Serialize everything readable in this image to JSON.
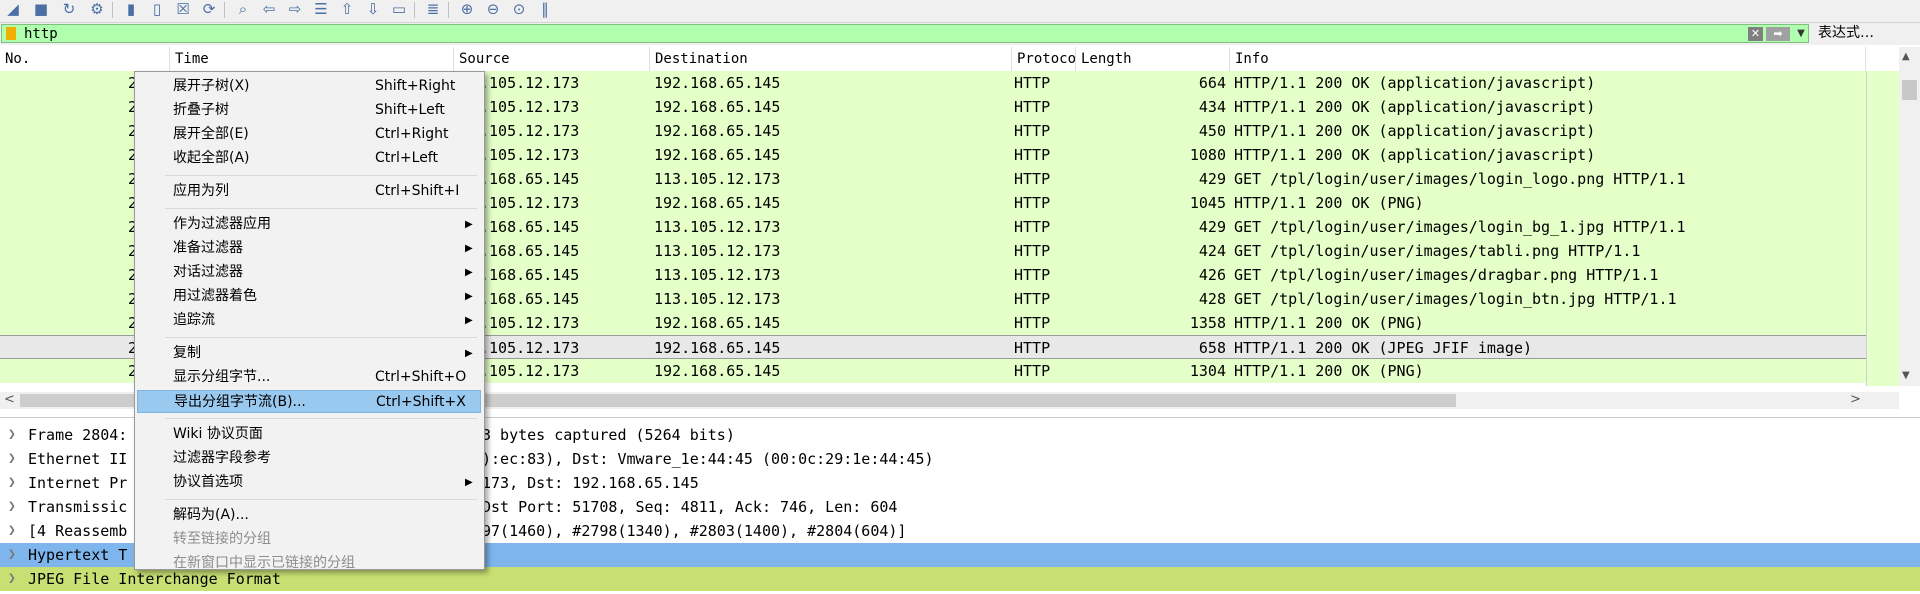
{
  "toolbar": {
    "icons": [
      "shark-fin-icon",
      "stop-icon",
      "restart-icon",
      "options-icon",
      "open-icon",
      "save-icon",
      "close-file-icon",
      "reload-icon",
      "find-icon",
      "back-icon",
      "forward-icon",
      "go-to-icon",
      "first-icon",
      "last-icon",
      "autoscroll-icon",
      "colorize-icon",
      "zoom-in-icon",
      "zoom-out-icon",
      "zoom-normal-icon",
      "resize-columns-icon"
    ]
  },
  "filter": {
    "value": "http",
    "expression_label": "表达式…"
  },
  "columns": [
    "No.",
    "Time",
    "Source",
    "Destination",
    "Protocol",
    "Length",
    "Info"
  ],
  "packets": [
    {
      "no": "2",
      "source": ".105.12.173",
      "destination": "192.168.65.145",
      "protocol": "HTTP",
      "length": "664",
      "info": "HTTP/1.1 200 OK  (application/javascript)"
    },
    {
      "no": "2",
      "source": ".105.12.173",
      "destination": "192.168.65.145",
      "protocol": "HTTP",
      "length": "434",
      "info": "HTTP/1.1 200 OK  (application/javascript)"
    },
    {
      "no": "2",
      "source": ".105.12.173",
      "destination": "192.168.65.145",
      "protocol": "HTTP",
      "length": "450",
      "info": "HTTP/1.1 200 OK  (application/javascript)"
    },
    {
      "no": "2",
      "source": ".105.12.173",
      "destination": "192.168.65.145",
      "protocol": "HTTP",
      "length": "1080",
      "info": "HTTP/1.1 200 OK  (application/javascript)"
    },
    {
      "no": "2",
      "source": ".168.65.145",
      "destination": "113.105.12.173",
      "protocol": "HTTP",
      "length": "429",
      "info": "GET /tpl/login/user/images/login_logo.png HTTP/1.1"
    },
    {
      "no": "2",
      "source": ".105.12.173",
      "destination": "192.168.65.145",
      "protocol": "HTTP",
      "length": "1045",
      "info": "HTTP/1.1 200 OK  (PNG)"
    },
    {
      "no": "2",
      "source": ".168.65.145",
      "destination": "113.105.12.173",
      "protocol": "HTTP",
      "length": "429",
      "info": "GET /tpl/login/user/images/login_bg_1.jpg HTTP/1.1"
    },
    {
      "no": "2",
      "source": ".168.65.145",
      "destination": "113.105.12.173",
      "protocol": "HTTP",
      "length": "424",
      "info": "GET /tpl/login/user/images/tabli.png HTTP/1.1"
    },
    {
      "no": "2",
      "source": ".168.65.145",
      "destination": "113.105.12.173",
      "protocol": "HTTP",
      "length": "426",
      "info": "GET /tpl/login/user/images/dragbar.png HTTP/1.1"
    },
    {
      "no": "2",
      "source": ".168.65.145",
      "destination": "113.105.12.173",
      "protocol": "HTTP",
      "length": "428",
      "info": "GET /tpl/login/user/images/login_btn.jpg HTTP/1.1"
    },
    {
      "no": "2",
      "source": ".105.12.173",
      "destination": "192.168.65.145",
      "protocol": "HTTP",
      "length": "1358",
      "info": "HTTP/1.1 200 OK  (PNG)"
    },
    {
      "no": "2",
      "source": ".105.12.173",
      "destination": "192.168.65.145",
      "protocol": "HTTP",
      "length": "658",
      "info": "HTTP/1.1 200 OK  (JPEG JFIF image)",
      "selected": true
    },
    {
      "no": "2",
      "source": ".105.12.173",
      "destination": "192.168.65.145",
      "protocol": "HTTP",
      "length": "1304",
      "info": "HTTP/1.1 200 OK  (PNG)"
    }
  ],
  "details": [
    {
      "text": "Frame 2804:",
      "tail": "3 bytes captured (5264 bits)"
    },
    {
      "text": "Ethernet II",
      "tail": "):ec:83), Dst: Vmware_1e:44:45 (00:0c:29:1e:44:45)"
    },
    {
      "text": "Internet Pr",
      "tail": "173, Dst: 192.168.65.145"
    },
    {
      "text": "Transmissic",
      "tail": "Dst Port: 51708, Seq: 4811, Ack: 746, Len: 604"
    },
    {
      "text": "[4 Reassemb",
      "tail": "97(1460), #2798(1340), #2803(1400), #2804(604)]"
    },
    {
      "text": "Hypertext T",
      "tail": ""
    },
    {
      "text": "JPEG File Interchange Format",
      "tail": ""
    }
  ],
  "context_menu": [
    {
      "label": "展开子树(X)",
      "shortcut": "Shift+Right"
    },
    {
      "label": "折叠子树",
      "shortcut": "Shift+Left"
    },
    {
      "label": "展开全部(E)",
      "shortcut": "Ctrl+Right"
    },
    {
      "label": "收起全部(A)",
      "shortcut": "Ctrl+Left"
    },
    {
      "sep": true
    },
    {
      "label": "应用为列",
      "shortcut": "Ctrl+Shift+I"
    },
    {
      "sep": true
    },
    {
      "label": "作为过滤器应用",
      "submenu": true
    },
    {
      "label": "准备过滤器",
      "submenu": true
    },
    {
      "label": "对话过滤器",
      "submenu": true
    },
    {
      "label": "用过滤器着色",
      "submenu": true
    },
    {
      "label": "追踪流",
      "submenu": true
    },
    {
      "sep": true
    },
    {
      "label": "复制",
      "submenu": true
    },
    {
      "label": "显示分组字节...",
      "shortcut": "Ctrl+Shift+O"
    },
    {
      "label": "导出分组字节流(B)...",
      "shortcut": "Ctrl+Shift+X",
      "active": true
    },
    {
      "sep": true
    },
    {
      "label": "Wiki 协议页面"
    },
    {
      "label": "过滤器字段参考"
    },
    {
      "label": "协议首选项",
      "submenu": true
    },
    {
      "sep": true
    },
    {
      "label": "解码为(A)..."
    },
    {
      "label": "转至链接的分组",
      "disabled": true
    },
    {
      "label": "在新窗口中显示已链接的分组",
      "disabled": true
    }
  ],
  "colors": {
    "row_bg": "#e4ffc7",
    "filter_bg": "#afffaf",
    "highlight_blue": "#7eb5ed",
    "highlight_green": "#c8df74",
    "menu_active": "#99c9ef"
  }
}
